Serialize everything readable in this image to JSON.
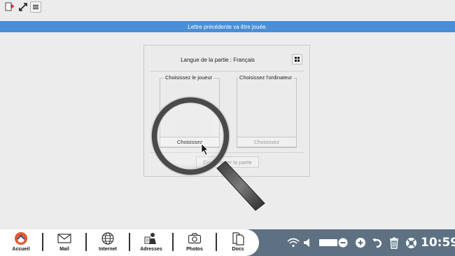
{
  "banner": {
    "text": "Lettre précédente va être jouée."
  },
  "panel": {
    "title": "Langue de la partie : Français",
    "player_label": "Choisissez le joueur",
    "computer_label": "Choisissez l'ordinateur",
    "player_button": "Choisissez",
    "computer_button": "Choisissez",
    "start_button": "Commencer la partie"
  },
  "dock": {
    "items": [
      {
        "label": "Accueil",
        "icon": "home-logo-icon"
      },
      {
        "label": "Mail",
        "icon": "mail-icon"
      },
      {
        "label": "Internet",
        "icon": "globe-icon"
      },
      {
        "label": "Adresses",
        "icon": "contacts-icon"
      },
      {
        "label": "Photos",
        "icon": "camera-icon"
      },
      {
        "label": "Docs",
        "icon": "documents-icon"
      }
    ]
  },
  "tray": {
    "clock": "10:59"
  },
  "colors": {
    "banner": "#4a8fd6",
    "tray": "#5d7183",
    "accent": "#e4572e"
  }
}
